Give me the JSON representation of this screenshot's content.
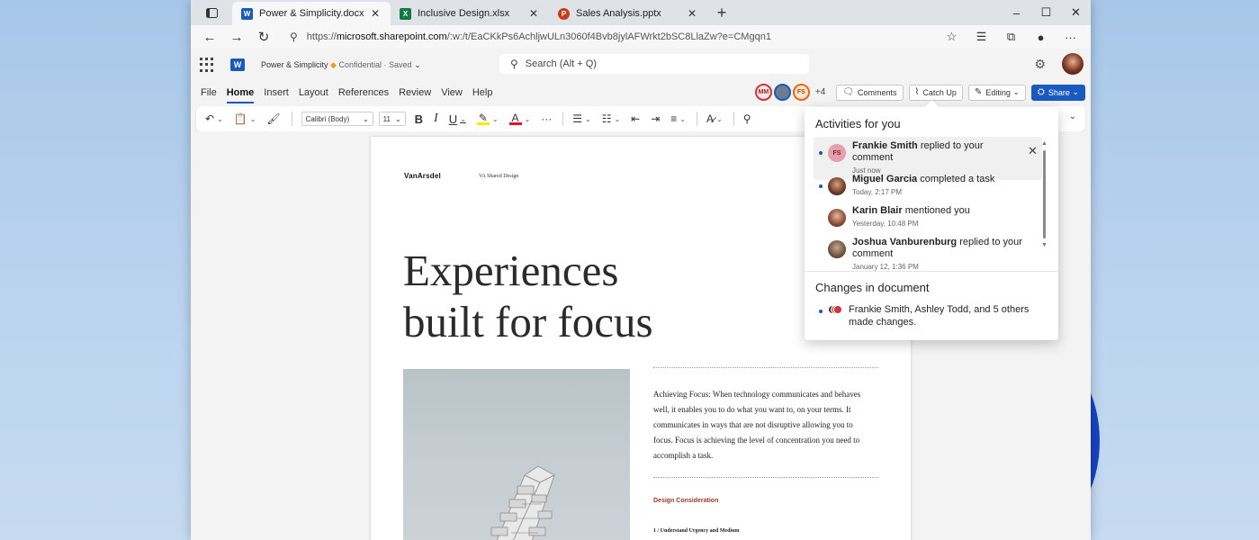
{
  "browser": {
    "tabs": [
      {
        "title": "Power & Simplicity.docx",
        "icon": "word-icon",
        "color": "#185abd",
        "active": true
      },
      {
        "title": "Inclusive Design.xlsx",
        "icon": "excel-icon",
        "color": "#107c41",
        "active": false
      },
      {
        "title": "Sales Analysis.pptx",
        "icon": "powerpoint-icon",
        "color": "#c43e1c",
        "active": false
      }
    ],
    "url_prefix": "https://",
    "url_host": "microsoft.sharepoint.com",
    "url_path": "/:w:/t/EaCKkPs6AchljwULn3060f4Bvb8jylAFWrkt2bSC8LlaZw?e=CMgqn1"
  },
  "app": {
    "doc_name": "Power & Simplicity",
    "doc_status": "Confidential · Saved",
    "search_placeholder": "Search (Alt + Q)"
  },
  "ribbon": {
    "tabs": [
      "File",
      "Home",
      "Insert",
      "Layout",
      "References",
      "Review",
      "View",
      "Help"
    ],
    "active_tab": "Home",
    "collaborators": [
      {
        "initials": "MM",
        "color": "#d13438"
      },
      {
        "initials": "",
        "color": "#185abd"
      },
      {
        "initials": "FS",
        "color": "#f7630c"
      }
    ],
    "more_count": "+4",
    "comments_label": "Comments",
    "catchup_label": "Catch Up",
    "editing_label": "Editing",
    "share_label": "Share"
  },
  "toolbar": {
    "font_name": "Calibri (Body)",
    "font_size": "11",
    "more": "···"
  },
  "document": {
    "brand": "VanArsdel",
    "brand_sub": "VA Shared Design",
    "headline_line1": "Experiences",
    "headline_line2": "built for focus",
    "body": "Achieving Focus: When technology communicates and behaves well, it enables you to do what you want to, on your terms. It communicates in ways that are not disruptive allowing you to focus. Focus is achieving the level of concentration you need to accomplish a task.",
    "section_heading": "Design Consideration",
    "step": "1 / Understand Urgency and Medium"
  },
  "activities": {
    "title": "Activities for you",
    "items": [
      {
        "name": "Frankie Smith",
        "action": "replied to your comment",
        "time": "Just now",
        "initials": "FS",
        "unread": true
      },
      {
        "name": "Miguel Garcia",
        "action": "completed a task",
        "time": "Today, 2:17 PM",
        "initials": "",
        "unread": true
      },
      {
        "name": "Karin Blair",
        "action": "mentioned you",
        "time": "Yesterday, 10:48 PM",
        "initials": "",
        "unread": false
      },
      {
        "name": "Joshua Vanburenburg",
        "action": "replied to your comment",
        "time": "January 12, 1:36 PM",
        "initials": "",
        "unread": false
      }
    ],
    "changes_title": "Changes in document",
    "changes_text": "Frankie Smith, Ashley Todd, and 5 others made changes."
  }
}
